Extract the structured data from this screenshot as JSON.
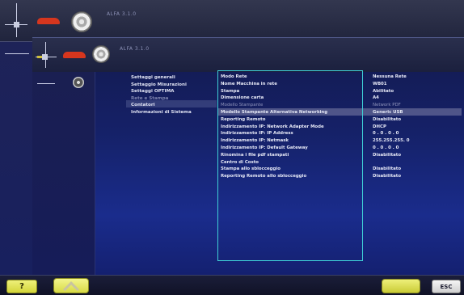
{
  "back_window": {
    "title": "ALFA 3.1.0"
  },
  "front_window": {
    "title": "ALFA 3.1.0"
  },
  "menu": {
    "items": [
      {
        "label": "Settaggi generali",
        "selected": false,
        "dim": false
      },
      {
        "label": "Settaggio Misurazioni",
        "selected": false,
        "dim": false
      },
      {
        "label": "Settaggi OPTIMA",
        "selected": false,
        "dim": false
      },
      {
        "label": "Rete e Stampa",
        "selected": true,
        "dim": true
      },
      {
        "label": "Contatori",
        "selected": false,
        "dim": false
      },
      {
        "label": "Informazioni di Sistema",
        "selected": false,
        "dim": false
      }
    ]
  },
  "settings": {
    "rows": [
      {
        "label": "Modo Rete",
        "value": "Nessuna Rete"
      },
      {
        "label": "Nome Macchina in rete",
        "value": "WB01"
      },
      {
        "label": "Stampa",
        "value": "Abilitato"
      },
      {
        "label": "Dimensione carta",
        "value": "A4"
      },
      {
        "label": "Modello Stampante",
        "value": "Network PDF",
        "dim": true
      },
      {
        "label": "Modello Stampante Alternativa Networking",
        "value": "Generic USB"
      },
      {
        "label": "Reporting Remoto",
        "value": "Disabilitato"
      },
      {
        "label": "Indirizzamento IP: Network Adapter Mode",
        "value": "DHCP"
      },
      {
        "label": "Indirizzamento IP: IP Address",
        "value": "0 . 0 . 0 . 0"
      },
      {
        "label": "Indirizzamento IP: Netmask",
        "value": "255.255.255. 0"
      },
      {
        "label": "Indirizzamento IP: Default Gateway",
        "value": "0 . 0 . 0 . 0"
      },
      {
        "label": "Rinomina i file pdf stampati",
        "value": "Disabilitato"
      },
      {
        "label": "Centro di Costo",
        "value": ""
      },
      {
        "label": "Stampa allo sblocceggio",
        "value": "Disabilitato"
      },
      {
        "label": "Reporting Remoto allo sblocceggio",
        "value": "Disabilitato"
      }
    ]
  },
  "bottom_bar": {
    "help_label": "?",
    "ok_label": "",
    "esc_label": "ESC"
  },
  "colors": {
    "accent_border": "#3fd0d6",
    "button_yellow": "#e3e55a",
    "car_red": "#d6361e"
  },
  "icons": [
    "axis-icon",
    "car-icon",
    "wheel-icon",
    "tie-rod-icon",
    "dial-icon",
    "chevron-up-icon",
    "help-icon"
  ]
}
